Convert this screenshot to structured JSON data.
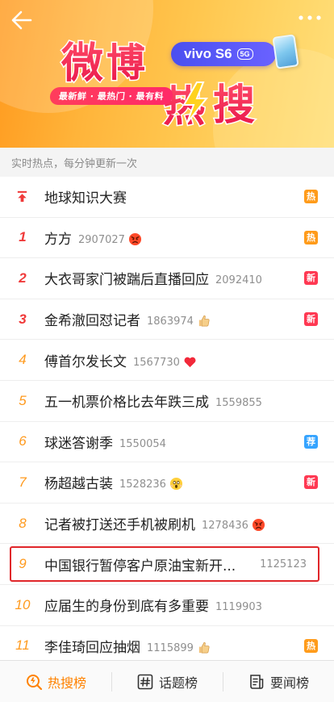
{
  "header": {
    "vivo_text": "vivo S6",
    "vivo_5g": "5G",
    "slogan": "最新鲜 · 最热门 · 最有料",
    "title_chars": [
      "微",
      "博",
      "热",
      "搜"
    ]
  },
  "subheader": "实时热点，每分钟更新一次",
  "rows": [
    {
      "rank": "↑",
      "title": "地球知识大赛",
      "count": "",
      "emoji": "",
      "tag": "热",
      "tag_type": "hot"
    },
    {
      "rank": "1",
      "title": "方方",
      "count": "2907027",
      "emoji": "angry-face",
      "tag": "热",
      "tag_type": "hot"
    },
    {
      "rank": "2",
      "title": "大衣哥家门被踹后直播回应",
      "count": "2092410",
      "emoji": "",
      "tag": "新",
      "tag_type": "new"
    },
    {
      "rank": "3",
      "title": "金希澈回怼记者",
      "count": "1863974",
      "emoji": "thumbs-up",
      "tag": "新",
      "tag_type": "new"
    },
    {
      "rank": "4",
      "title": "傅首尔发长文",
      "count": "1567730",
      "emoji": "heart",
      "tag": "",
      "tag_type": ""
    },
    {
      "rank": "5",
      "title": "五一机票价格比去年跌三成",
      "count": "1559855",
      "emoji": "",
      "tag": "",
      "tag_type": ""
    },
    {
      "rank": "6",
      "title": "球迷答谢季",
      "count": "1550054",
      "emoji": "",
      "tag": "荐",
      "tag_type": "rec"
    },
    {
      "rank": "7",
      "title": "杨超越古装",
      "count": "1528236",
      "emoji": "scream-face",
      "tag": "新",
      "tag_type": "new"
    },
    {
      "rank": "8",
      "title": "记者被打送还手机被刷机",
      "count": "1278436",
      "emoji": "angry-face",
      "tag": "",
      "tag_type": ""
    },
    {
      "rank": "9",
      "title": "中国银行暂停客户原油宝新开...",
      "count": "1125123",
      "emoji": "",
      "tag": "",
      "tag_type": "",
      "highlight": true
    },
    {
      "rank": "10",
      "title": "应届生的身份到底有多重要",
      "count": "1119903",
      "emoji": "",
      "tag": "",
      "tag_type": ""
    },
    {
      "rank": "11",
      "title": "李佳琦回应抽烟",
      "count": "1115899",
      "emoji": "thumbs-up",
      "tag": "热",
      "tag_type": "hot"
    }
  ],
  "bottom_nav": [
    {
      "label": "热搜榜",
      "icon": "search-icon",
      "active": true
    },
    {
      "label": "话题榜",
      "icon": "hashtag-icon",
      "active": false
    },
    {
      "label": "要闻榜",
      "icon": "news-icon",
      "active": false
    }
  ],
  "colors": {
    "hot": "#ff9b1a",
    "new": "#ff3852",
    "rec": "#36a4ff",
    "accent": "#ff8200",
    "highlight_border": "#e0262a"
  }
}
